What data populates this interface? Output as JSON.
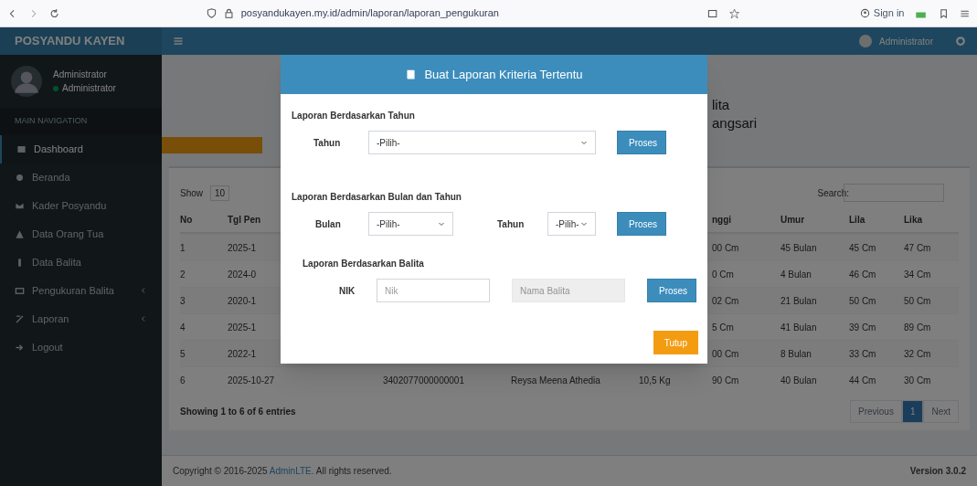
{
  "browser": {
    "url": "posyandukayen.my.id/admin/laporan/laporan_pengukuran",
    "sign_in": "Sign in"
  },
  "brand": "POSYANDU KAYEN",
  "user": {
    "name": "Administrator",
    "role": "Administrator"
  },
  "topbar_user": "Administrator",
  "nav_header": "MAIN NAVIGATION",
  "sidebar": {
    "items": [
      {
        "label": "Dashboard",
        "has_submenu": false,
        "selected": true
      },
      {
        "label": "Beranda",
        "has_submenu": false,
        "selected": false
      },
      {
        "label": "Kader Posyandu",
        "has_submenu": false,
        "selected": false
      },
      {
        "label": "Data Orang Tua",
        "has_submenu": false,
        "selected": false
      },
      {
        "label": "Data Balita",
        "has_submenu": false,
        "selected": false
      },
      {
        "label": "Pengukuran Balita",
        "has_submenu": true,
        "selected": false
      },
      {
        "label": "Laporan",
        "has_submenu": true,
        "selected": false
      },
      {
        "label": "Logout",
        "has_submenu": false,
        "selected": false
      }
    ]
  },
  "page_title": [
    "lita",
    "angsari"
  ],
  "show_label": "Show",
  "show_value": "10",
  "search_label": "Search:",
  "table": {
    "columns": {
      "no": "No",
      "tgl": "Tgl Pen",
      "tinggi": "nggi",
      "umur": "Umur",
      "lila": "Lila",
      "lika": "Lika"
    },
    "rows": [
      {
        "no": "1",
        "tgl": "2025-1",
        "tinggi": "00 Cm",
        "umur": "45 Bulan",
        "lila": "45 Cm",
        "lika": "47 Cm"
      },
      {
        "no": "2",
        "tgl": "2024-0",
        "tinggi": "0 Cm",
        "umur": "4 Bulan",
        "lila": "46 Cm",
        "lika": "34 Cm"
      },
      {
        "no": "3",
        "tgl": "2020-1",
        "tinggi": "02 Cm",
        "umur": "21 Bulan",
        "lila": "50 Cm",
        "lika": "50 Cm"
      },
      {
        "no": "4",
        "tgl": "2025-1",
        "tinggi": "5 Cm",
        "umur": "41 Bulan",
        "lila": "39 Cm",
        "lika": "89 Cm"
      },
      {
        "no": "5",
        "tgl": "2022-1",
        "tinggi": "00 Cm",
        "umur": "8 Bulan",
        "lila": "33 Cm",
        "lika": "32 Cm"
      },
      {
        "no": "6",
        "tgl": "2025-10-27",
        "nik": "3402077000000001",
        "nama": "Reysa Meena Athedia",
        "bb": "10,5 Kg",
        "tinggi": "90 Cm",
        "umur": "40 Bulan",
        "lila": "44 Cm",
        "lika": "30 Cm"
      }
    ]
  },
  "showing": "Showing 1 to 6 of 6 entries",
  "pagination": [
    {
      "label": "Previous",
      "selected": false
    },
    {
      "label": "1",
      "selected": true
    },
    {
      "label": "Next",
      "selected": false
    }
  ],
  "footer": {
    "copyright": "Copyright © 2016-2025",
    "link": "AdminLTE.",
    "rest": "All rights reserved.",
    "version": "Version 3.0.2"
  },
  "modal": {
    "title": "Buat Laporan Kriteria Tertentu",
    "section_year": {
      "heading": "Laporan Berdasarkan Tahun",
      "label": "Tahun",
      "select": "-Pilih-",
      "button": "Proses"
    },
    "section_month": {
      "heading": "Laporan Berdasarkan Bulan dan Tahun",
      "month_label": "Bulan",
      "month_select": "-Pilih-",
      "year_label": "Tahun",
      "year_select": "-Pilih-",
      "button": "Proses"
    },
    "section_child": {
      "heading": "Laporan Berdasarkan Balita",
      "label": "NIK",
      "nik_placeholder": "Nik",
      "name_placeholder": "Nama Balita",
      "button": "Proses"
    },
    "close": "Tutup"
  }
}
